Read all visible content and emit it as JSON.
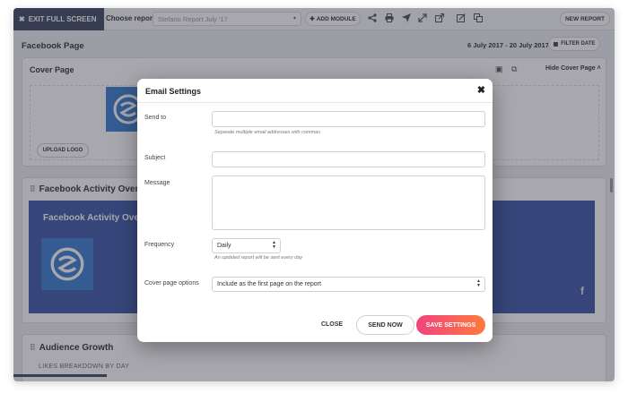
{
  "toolbar": {
    "exit_fullscreen": "EXIT FULL SCREEN",
    "choose_report_label": "Choose report",
    "report_select_value": "Stefano Report July '17",
    "add_module": "ADD MODULE",
    "new_report": "NEW REPORT"
  },
  "page": {
    "title": "Facebook Page",
    "date_range": "6 July 2017 - 20 July 2017",
    "filter_date": "FILTER DATE"
  },
  "cover_page": {
    "title": "Cover Page",
    "hide_label": "Hide Cover Page",
    "upload_logo": "UPLOAD LOGO"
  },
  "activity": {
    "title": "Facebook Activity Overview",
    "banner_title": "Facebook Activity Overview"
  },
  "audience": {
    "title": "Audience Growth",
    "subtitle": "LIKES BREAKDOWN BY DAY"
  },
  "scroll_progress": 0.155,
  "modal": {
    "title": "Email Settings",
    "send_to_label": "Send to",
    "send_to_value": "",
    "send_to_hint": "Separate multiple email addresses with commas",
    "subject_label": "Subject",
    "subject_value": "",
    "message_label": "Message",
    "message_value": "",
    "frequency_label": "Frequency",
    "frequency_value": "Daily",
    "frequency_hint": "An updated report will be sent every day",
    "cover_options_label": "Cover page options",
    "cover_options_value": "Include as the first page on the report",
    "close_label": "CLOSE",
    "send_now_label": "SEND NOW",
    "save_label": "SAVE SETTINGS"
  },
  "colors": {
    "toolbar_dark": "#3f4a63",
    "facebook_blue": "#3d58a8",
    "logo_blue": "#3a7fd0",
    "save_gradient_start": "#f0437e",
    "save_gradient_end": "#ff7a3d"
  }
}
